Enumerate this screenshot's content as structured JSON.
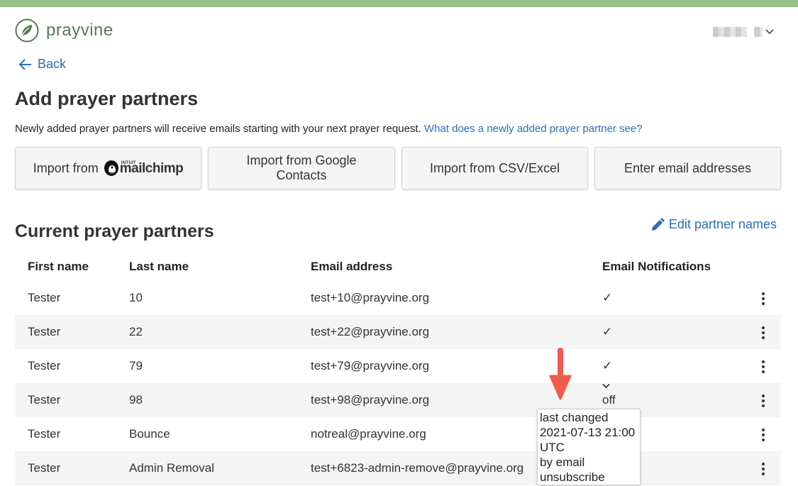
{
  "brand": {
    "name": "prayvine",
    "color": "#557a52",
    "topbar_color": "#97bf8a"
  },
  "nav": {
    "back_label": "Back"
  },
  "page": {
    "title": "Add prayer partners",
    "intro_text": "Newly added prayer partners will receive emails starting with your next prayer request.",
    "intro_link": "What does a newly added prayer partner see?"
  },
  "import_buttons": {
    "mailchimp_prefix": "Import from",
    "mailchimp_brand_small": "INTUIT",
    "mailchimp_brand": "mailchimp",
    "google": "Import from Google Contacts",
    "csv": "Import from CSV/Excel",
    "manual": "Enter email addresses"
  },
  "partners": {
    "title": "Current prayer partners",
    "edit_label": "Edit partner names",
    "columns": [
      "First name",
      "Last name",
      "Email address",
      "Email Notifications"
    ],
    "rows": [
      {
        "first": "Tester",
        "last": "10",
        "email": "test+10@prayvine.org",
        "notify": "✓"
      },
      {
        "first": "Tester",
        "last": "22",
        "email": "test+22@prayvine.org",
        "notify": "✓"
      },
      {
        "first": "Tester",
        "last": "79",
        "email": "test+79@prayvine.org",
        "notify": "✓"
      },
      {
        "first": "Tester",
        "last": "98",
        "email": "test+98@prayvine.org",
        "notify": "off"
      },
      {
        "first": "Tester",
        "last": "Bounce",
        "email": "notreal@prayvine.org",
        "notify": ""
      },
      {
        "first": "Tester",
        "last": "Admin Removal",
        "email": "test+6823-admin-remove@prayvine.org",
        "notify": ""
      }
    ]
  },
  "tooltip": {
    "line1": "last changed",
    "line2": "2021-07-13 21:00",
    "line3": "UTC",
    "line4": "by email",
    "line5": "unsubscribe"
  },
  "colors": {
    "link": "#2a6fb8",
    "alt_row": "#f4f4f4",
    "arrow": "#f05a4f"
  }
}
